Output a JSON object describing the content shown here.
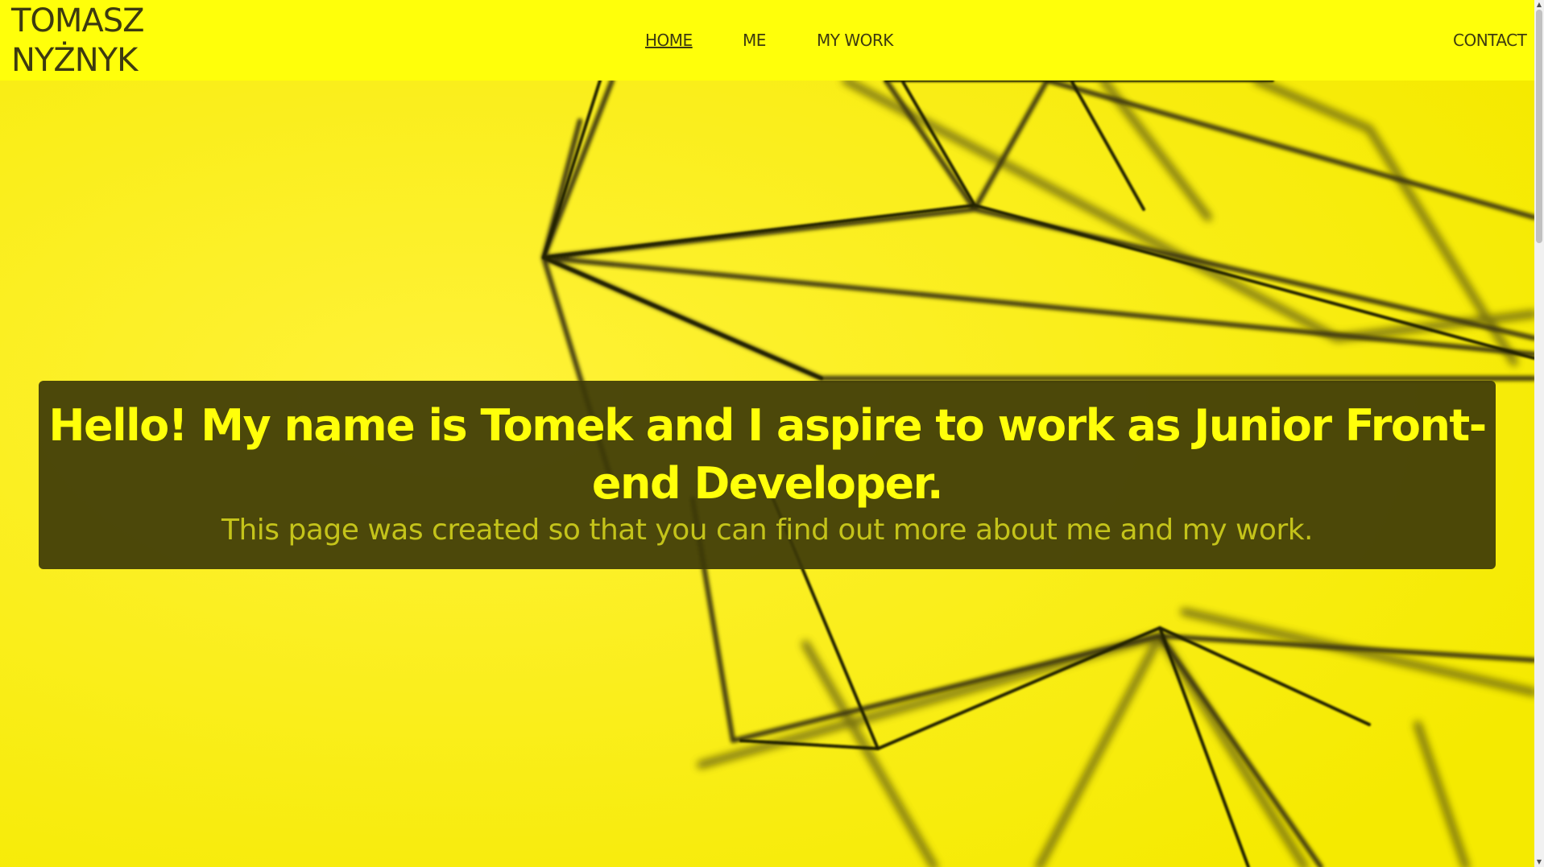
{
  "brand": {
    "line1": "TOMASZ",
    "line2": "NYŻNYK"
  },
  "nav": {
    "home": "HOME",
    "me": "ME",
    "my_work": "MY WORK",
    "contact": "CONTACT"
  },
  "hero": {
    "title": "Hello! My name is Tomek and I aspire to work as Junior Front-end Developer.",
    "subtitle": "This page was created so that you can find out more about me and my work.",
    "background_description": "geometric-wire-sculpture",
    "background_color": "#ffff0a",
    "box_color": "#3d3a08",
    "title_color": "#ffff0a",
    "subtitle_color": "#c4c31a"
  },
  "scrollbar": {
    "up_icon": "▲",
    "down_icon": "▼"
  }
}
